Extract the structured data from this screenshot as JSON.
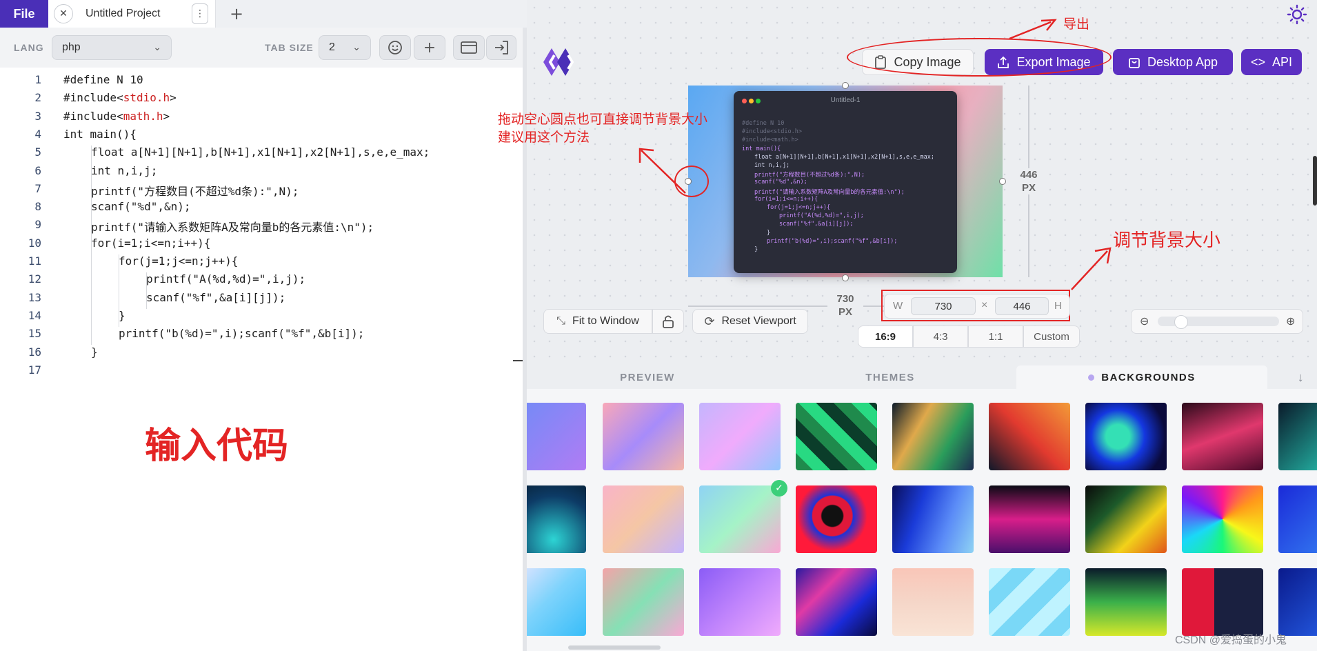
{
  "app": {
    "file_label": "File",
    "project_tab": "Untitled Project"
  },
  "toolbar": {
    "lang_label": "LANG",
    "lang_value": "php",
    "tab_size_label": "TAB SIZE",
    "tab_size_value": "2"
  },
  "editor": {
    "line_numbers": [
      "1",
      "2",
      "3",
      "4",
      "5",
      "6",
      "7",
      "8",
      "9",
      "10",
      "11",
      "12",
      "13",
      "14",
      "15",
      "16",
      "17"
    ],
    "lines": [
      "#define N 10",
      "#include<stdio.h>",
      "#include<math.h>",
      "int main(){",
      "  float a[N+1][N+1],b[N+1],x1[N+1],x2[N+1],s,e,e_max;",
      "  int n,i,j;",
      "  printf(\"方程数目(不超过%d条):\",N);",
      "  scanf(\"%d\",&n);",
      "  printf(\"请输入系数矩阵A及常向量b的各元素值:\\n\");",
      "  for(i=1;i<=n;i++){",
      "    for(j=1;j<=n;j++){",
      "      printf(\"A(%d,%d)=\",i,j);",
      "      scanf(\"%f\",&a[i][j]);",
      "    }",
      "    printf(\"b(%d)=\",i);scanf(\"%f\",&b[i]);",
      "  }",
      ""
    ]
  },
  "annotations": {
    "input_code": "输入代码",
    "export": "导出",
    "drag_hint_1": "拖动空心圆点也可直接调节背景大小",
    "drag_hint_2": "建议用这个方法",
    "resize_bg": "调节背景大小"
  },
  "actions": {
    "copy_image": "Copy Image",
    "export_image": "Export Image",
    "desktop_app": "Desktop App",
    "api": "API"
  },
  "preview": {
    "window_title": "Untitled-1",
    "height_value": "446",
    "width_value": "730",
    "unit": "PX"
  },
  "size_controls": {
    "w_label": "W",
    "w_value": "730",
    "times": "×",
    "h_value": "446",
    "h_label": "H",
    "ratios": [
      "16:9",
      "4:3",
      "1:1",
      "Custom"
    ],
    "active_ratio": "16:9"
  },
  "viewport": {
    "fit_to_window": "Fit to Window",
    "reset_viewport": "Reset Viewport"
  },
  "panel_tabs": {
    "preview": "PREVIEW",
    "themes": "THEMES",
    "backgrounds": "BACKGROUNDS",
    "active": "BACKGROUNDS"
  },
  "watermark": "CSDN @爱捣蛋的小鬼",
  "colors": {
    "brand": "#5b2fc2",
    "annotation": "#e32424"
  }
}
